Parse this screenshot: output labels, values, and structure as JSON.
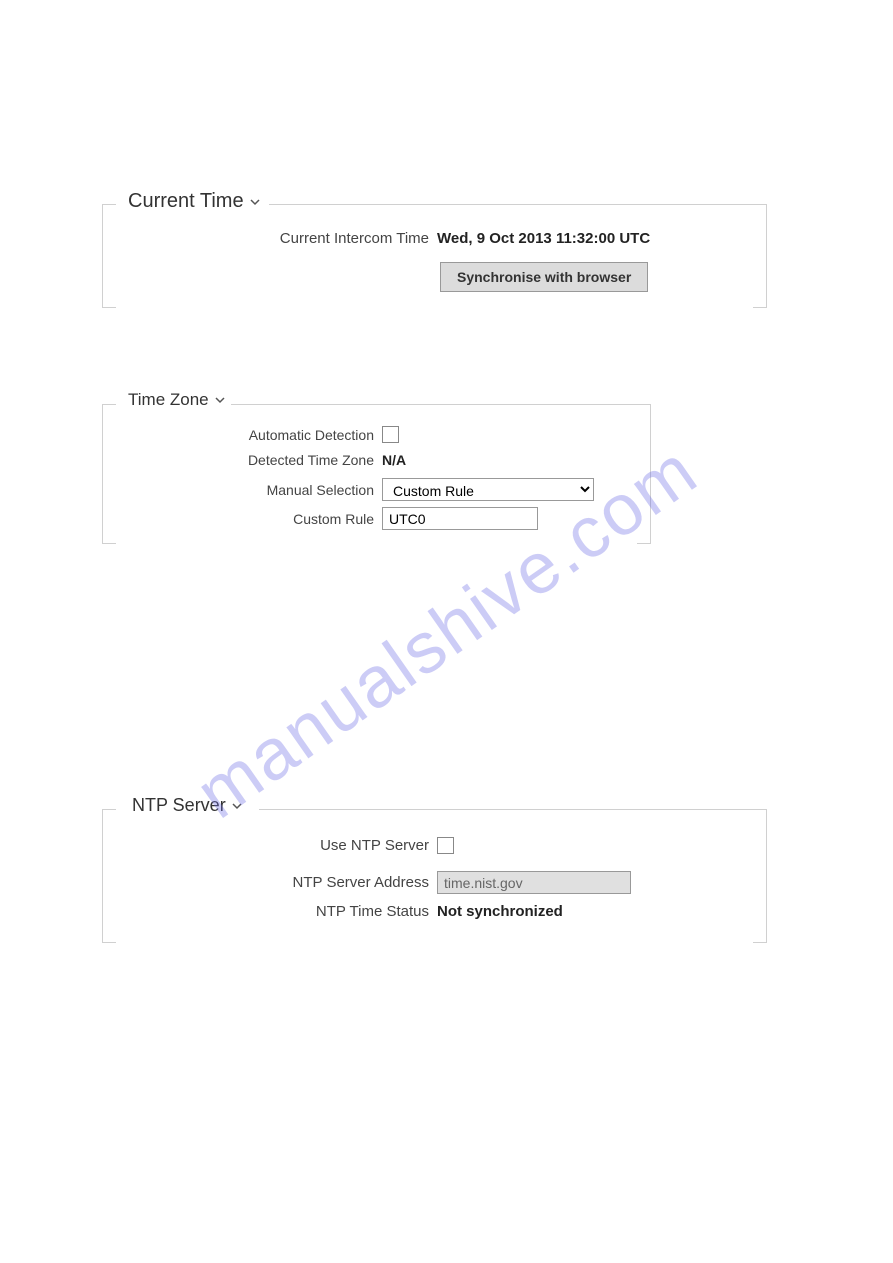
{
  "watermark": "manualshive.com",
  "sections": {
    "currentTime": {
      "legend": "Current Time",
      "rows": {
        "intercomTime": {
          "label": "Current Intercom Time",
          "value": "Wed, 9 Oct 2013 11:32:00 UTC"
        },
        "syncButton": {
          "label": "Synchronise with browser"
        }
      }
    },
    "timeZone": {
      "legend": "Time Zone",
      "rows": {
        "autoDetect": {
          "label": "Automatic Detection",
          "checked": false
        },
        "detected": {
          "label": "Detected Time Zone",
          "value": "N/A"
        },
        "manual": {
          "label": "Manual Selection",
          "value": "Custom Rule"
        },
        "custom": {
          "label": "Custom Rule",
          "value": "UTC0"
        }
      }
    },
    "ntp": {
      "legend": "NTP Server",
      "rows": {
        "useServer": {
          "label": "Use NTP Server",
          "checked": false
        },
        "address": {
          "label": "NTP Server Address",
          "value": "time.nist.gov"
        },
        "status": {
          "label": "NTP Time Status",
          "value": "Not synchronized"
        }
      }
    }
  }
}
